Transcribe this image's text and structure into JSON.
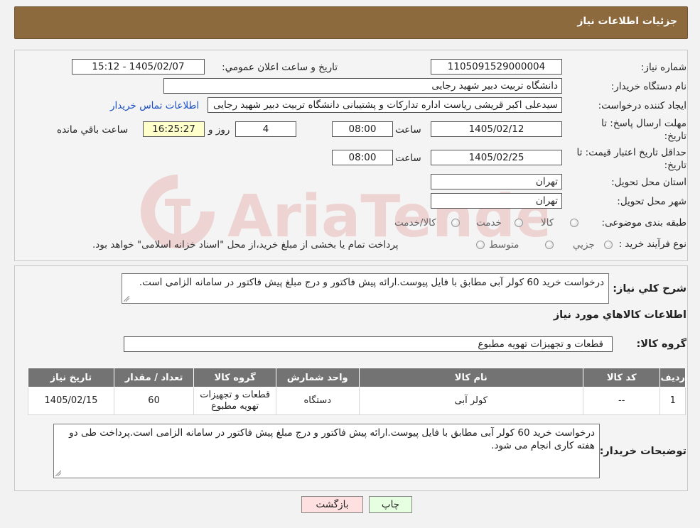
{
  "header": {
    "title": "جزئیات اطلاعات نیاز"
  },
  "form": {
    "need_number_label": "شماره نیاز:",
    "need_number": "1105091529000004",
    "announce_label": "تاریخ و ساعت اعلان عمومي:",
    "announce_value": "1405/02/07 - 15:12",
    "buyer_org_label": "نام دستگاه خریدار:",
    "buyer_org": "دانشگاه تربیت دبیر شهید رجایی",
    "requester_label": "ایجاد کننده درخواست:",
    "requester": "سیدعلی اکبر قریشی ریاست اداره تدارکات و پشتیبانی دانشگاه تربیت دبیر شهید رجایی",
    "contact_link": "اطلاعات تماس خریدار",
    "deadline_label_1": "مهلت ارسال پاسخ: تا",
    "deadline_label_2": "تاریخ:",
    "deadline_date": "1405/02/12",
    "time_label": "ساعت",
    "deadline_time": "08:00",
    "days_value": "4",
    "days_label": "روز و",
    "remaining_time": "16:25:27",
    "remaining_label": "ساعت باقي مانده",
    "validity_label_1": "حداقل تاريخ اعتبار قيمت: تا",
    "validity_label_2": "تاريخ:",
    "validity_date": "1405/02/25",
    "validity_time": "08:00",
    "province_label": "استان محل تحویل:",
    "province": "تهران",
    "city_label": "شهر محل تحویل:",
    "city": "تهران",
    "category_label": "طبقه بندی موضوعی:",
    "category_options": [
      "کالا",
      "خدمت",
      "کالا/خدمت"
    ],
    "process_label": "نوع فرآیند خرید :",
    "process_options": [
      "جزیي",
      "متوسط"
    ],
    "process_note": "پرداخت تمام یا بخشی از مبلغ خرید،از محل \"اسناد خزانه اسلامی\" خواهد بود."
  },
  "summary": {
    "label": "شرح کلي نياز:",
    "text": "درخواست خرید 60 کولر آبی مطابق با فایل پیوست.ارائه پیش فاکتور و درج مبلغ پیش فاکتور در سامانه الزامی است.",
    "items_title": "اطلاعات کالاهاي مورد نياز",
    "group_label": "گروه کالا:",
    "group_value": "قطعات و تجهیزات تهویه مطبوع"
  },
  "table": {
    "columns": [
      "رديف",
      "کد کالا",
      "نام کالا",
      "واحد شمارش",
      "گروه کالا",
      "تعداد / مقدار",
      "تاريخ نياز"
    ],
    "rows": [
      [
        "1",
        "--",
        "کولر آبی",
        "دستگاه",
        "قطعات و تجهیزات تهویه مطبوع",
        "60",
        "1405/02/15"
      ]
    ]
  },
  "buyer_notes": {
    "label": "توضيحات خريدار:",
    "text": "درخواست خرید 60 کولر آبی مطابق با فایل پیوست.ارائه پیش فاکتور و درج مبلغ پیش فاکتور در سامانه الزامی است.پرداخت طی دو هفته کاری انجام می شود."
  },
  "buttons": {
    "print": "چاپ",
    "back": "بازگشت"
  },
  "watermark": {
    "text": "AriaTender.neT"
  },
  "colors": {
    "header": "#8c6a3e",
    "table_header": "#737373",
    "link": "#1a4fc4",
    "back_button": "#ffe0e0",
    "print_button": "#e6ffe0"
  }
}
